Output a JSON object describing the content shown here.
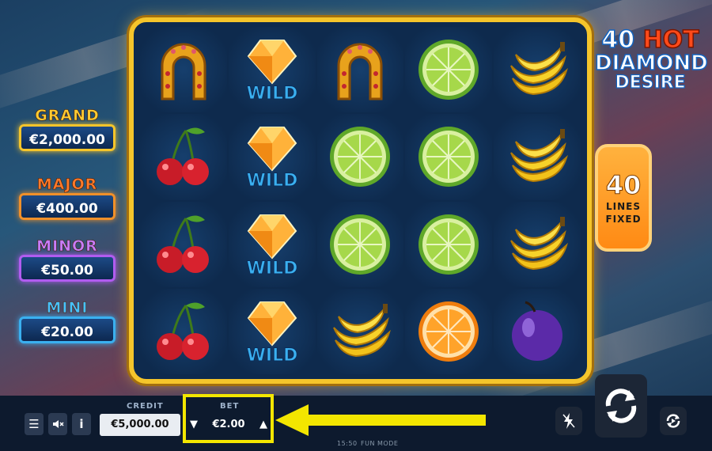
{
  "game": {
    "logo": {
      "number": "40",
      "hot": "HOT",
      "line2": "DIAMOND",
      "line3": "DESIRE"
    },
    "lines_badge": {
      "number": "40",
      "line1": "LINES",
      "line2": "FIXED"
    }
  },
  "jackpots": [
    {
      "name": "GRAND",
      "value": "€2,000.00",
      "color": "#ffcc33",
      "border": "#f5c52b"
    },
    {
      "name": "MAJOR",
      "value": "€400.00",
      "color": "#ff7a2a",
      "border": "#f0902a"
    },
    {
      "name": "MINOR",
      "value": "€50.00",
      "color": "#c77dff",
      "border": "#b15cf0"
    },
    {
      "name": "MINI",
      "value": "€20.00",
      "color": "#47c2ff",
      "border": "#3ab0f0"
    }
  ],
  "reels": {
    "rows": [
      [
        "horseshoe",
        "wild",
        "horseshoe",
        "lime",
        "banana"
      ],
      [
        "cherry",
        "wild",
        "lime",
        "lime",
        "banana"
      ],
      [
        "cherry",
        "wild",
        "lime",
        "lime",
        "banana"
      ],
      [
        "cherry",
        "wild",
        "banana",
        "orange",
        "plum"
      ]
    ],
    "wild_label": "WILD"
  },
  "bottom_bar": {
    "credit_label": "CREDIT",
    "credit_value": "€5,000.00",
    "bet_label": "BET",
    "bet_value": "€2.00",
    "bet_down": "▼",
    "bet_up": "▲",
    "menu_icon": "☰",
    "sound_icon": "🔈",
    "info_icon": "i",
    "time": "15:50",
    "mode": "FUN MODE"
  },
  "colors": {
    "highlight": "#f3e600",
    "frame": "#f5c52b"
  }
}
